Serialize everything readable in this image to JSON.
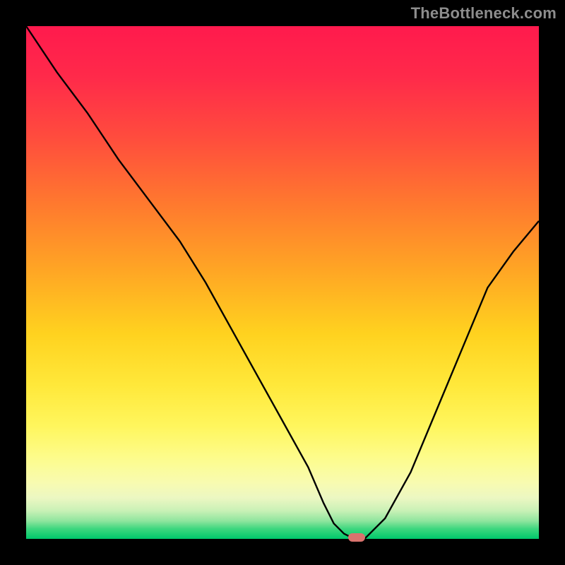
{
  "watermark": "TheBottleneck.com",
  "marker_color": "#d9736e",
  "chart_data": {
    "type": "line",
    "title": "",
    "xlabel": "",
    "ylabel": "",
    "xlim": [
      0,
      100
    ],
    "ylim": [
      0,
      100
    ],
    "series": [
      {
        "name": "curve",
        "x": [
          0,
          6,
          12,
          18,
          24,
          30,
          35,
          40,
          45,
          50,
          55,
          58,
          60,
          62,
          64,
          66,
          70,
          75,
          80,
          85,
          90,
          95,
          100
        ],
        "y": [
          100,
          91,
          83,
          74,
          66,
          58,
          50,
          41,
          32,
          23,
          14,
          7,
          3,
          1,
          0,
          0,
          4,
          13,
          25,
          37,
          49,
          56,
          62
        ]
      }
    ],
    "marker": {
      "x": 64.5,
      "y": 0
    }
  }
}
